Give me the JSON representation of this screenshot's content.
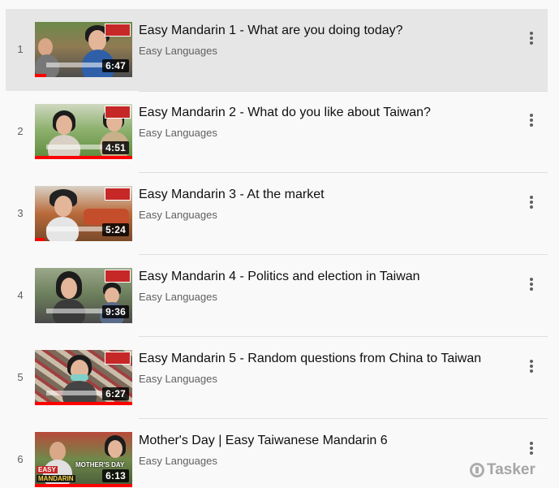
{
  "playlist": {
    "items": [
      {
        "index": "1",
        "title": "Easy Mandarin 1 - What are you doing today?",
        "channel": "Easy Languages",
        "duration": "6:47",
        "watched_fraction": 0.1,
        "active": true
      },
      {
        "index": "2",
        "title": "Easy Mandarin 2 - What do you like about Taiwan?",
        "channel": "Easy Languages",
        "duration": "4:51",
        "watched_fraction": 1.0,
        "active": false
      },
      {
        "index": "3",
        "title": "Easy Mandarin 3 - At the market",
        "channel": "Easy Languages",
        "duration": "5:24",
        "watched_fraction": 0.1,
        "active": false
      },
      {
        "index": "4",
        "title": "Easy Mandarin 4 - Politics and election in Taiwan",
        "channel": "Easy Languages",
        "duration": "9:36",
        "watched_fraction": 0.0,
        "active": false
      },
      {
        "index": "5",
        "title": "Easy Mandarin 5 - Random questions from China to Taiwan",
        "channel": "Easy Languages",
        "duration": "6:27",
        "watched_fraction": 1.0,
        "active": false
      },
      {
        "index": "6",
        "title": "Mother's Day | Easy Taiwanese Mandarin 6",
        "channel": "Easy Languages",
        "duration": "6:13",
        "watched_fraction": 1.0,
        "active": false,
        "thumb_caption_1": "EASY",
        "thumb_caption_2": "MANDARIN",
        "thumb_caption_3": "MOTHER'S DAY"
      }
    ]
  },
  "watermark": {
    "text": "Tasker"
  },
  "colors": {
    "background": "#f9f9f9",
    "active_row": "#e6e6e6",
    "progress": "#ff0000",
    "title_text": "#0f0f0f",
    "secondary_text": "#606060"
  }
}
